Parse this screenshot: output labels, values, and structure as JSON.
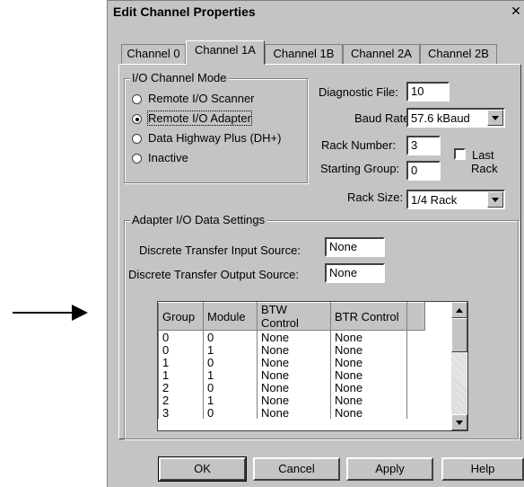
{
  "dialog": {
    "title": "Edit Channel Properties",
    "close_glyph": "✕"
  },
  "tabs": [
    "Channel 0",
    "Channel 1A",
    "Channel 1B",
    "Channel 2A",
    "Channel 2B"
  ],
  "active_tab": "Channel 1A",
  "io_mode": {
    "title": "I/O Channel Mode",
    "options": [
      "Remote I/O Scanner",
      "Remote I/O Adapter",
      "Data Highway Plus (DH+)",
      "Inactive"
    ],
    "selected": "Remote I/O Adapter"
  },
  "fields": {
    "diagnostic_file_label": "Diagnostic File:",
    "diagnostic_file_value": "10",
    "baud_rate_label": "Baud Rate:",
    "baud_rate_value": "57.6 kBaud",
    "rack_number_label": "Rack Number:",
    "rack_number_value": "3",
    "last_rack_label_1": "Last",
    "last_rack_label_2": "Rack",
    "starting_group_label": "Starting Group:",
    "starting_group_value": "0",
    "rack_size_label": "Rack Size:",
    "rack_size_value": "1/4 Rack"
  },
  "adapter": {
    "title": "Adapter I/O Data Settings",
    "input_source_label": "Discrete Transfer Input Source:",
    "input_source_value": "None",
    "output_source_label": "Discrete Transfer Output Source:",
    "output_source_value": "None"
  },
  "table": {
    "columns": [
      "Group",
      "Module",
      "BTW Control",
      "BTR Control"
    ],
    "rows": [
      [
        "0",
        "0",
        "None",
        "None"
      ],
      [
        "0",
        "1",
        "None",
        "None"
      ],
      [
        "1",
        "0",
        "None",
        "None"
      ],
      [
        "1",
        "1",
        "None",
        "None"
      ],
      [
        "2",
        "0",
        "None",
        "None"
      ],
      [
        "2",
        "1",
        "None",
        "None"
      ],
      [
        "3",
        "0",
        "None",
        "None"
      ]
    ]
  },
  "buttons": {
    "ok": "OK",
    "cancel": "Cancel",
    "apply": "Apply",
    "help": "Help"
  }
}
